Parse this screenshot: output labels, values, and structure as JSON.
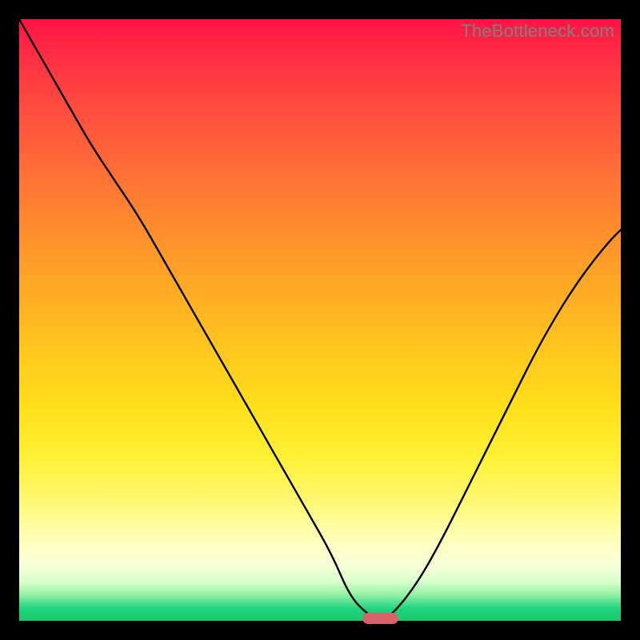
{
  "watermark": "TheBottleneck.com",
  "colors": {
    "frame": "#000000",
    "watermark": "#808080",
    "curve": "#000000",
    "marker": "#d9636b"
  },
  "chart_data": {
    "type": "line",
    "title": "",
    "xlabel": "",
    "ylabel": "",
    "xlim": [
      0,
      100
    ],
    "ylim": [
      0,
      100
    ],
    "grid": false,
    "legend": false,
    "x": [
      0,
      4,
      8,
      12,
      16,
      20,
      24,
      28,
      32,
      36,
      40,
      44,
      48,
      52,
      55,
      58,
      60,
      62,
      66,
      70,
      74,
      78,
      82,
      86,
      90,
      94,
      98,
      100
    ],
    "values": [
      100,
      93,
      86,
      79,
      73,
      67,
      60,
      53,
      46,
      39,
      32,
      25,
      18,
      11,
      4,
      1,
      0,
      1,
      6,
      13,
      21,
      29,
      37,
      45,
      52,
      58,
      63,
      65
    ],
    "marker": {
      "x_center": 60,
      "y": 0,
      "width_x": 6
    },
    "annotations": []
  }
}
